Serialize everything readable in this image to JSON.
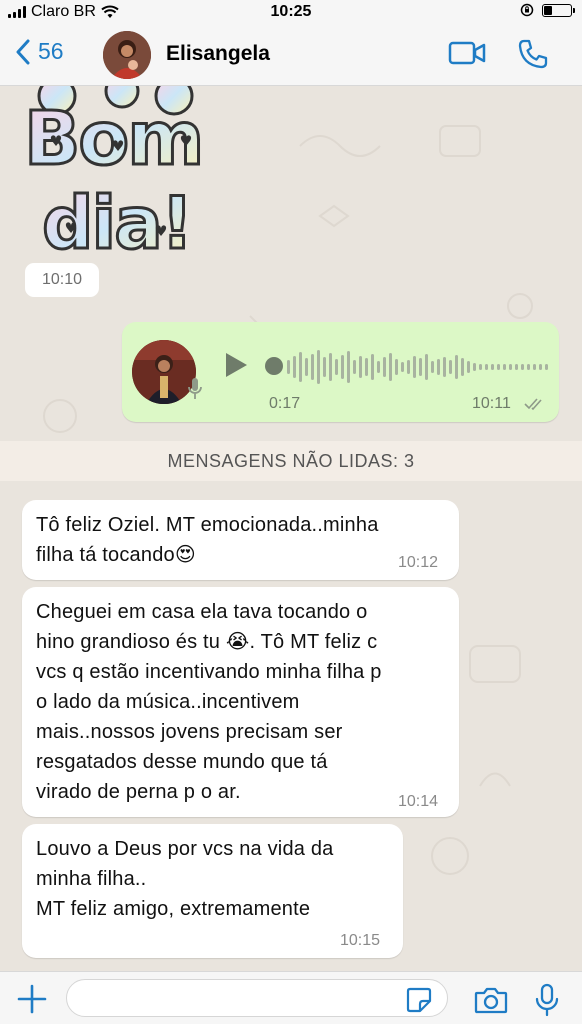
{
  "status_bar": {
    "carrier": "Claro BR",
    "time": "10:25"
  },
  "header": {
    "back_count": "56",
    "contact_name": "Elisangela"
  },
  "sticker": {
    "line1": "Bom",
    "line2": "dia!",
    "time": "10:10"
  },
  "voice_message": {
    "duration": "0:17",
    "time": "10:11",
    "status": "read"
  },
  "unread_banner": "MENSAGENS NÃO LIDAS: 3",
  "messages": [
    {
      "lines": [
        "Tô feliz Oziel. MT emocionada..minha",
        "filha tá tocando😍"
      ],
      "time": "10:12"
    },
    {
      "lines": [
        "Cheguei em casa ela tava tocando o",
        "hino grandioso és tu 😭. Tô MT feliz c",
        "vcs q estão incentivando minha filha p",
        "o lado da música..incentivem",
        "mais..nossos jovens precisam ser",
        "resgatados desse mundo que tá",
        "virado de perna p o ar."
      ],
      "time": "10:14"
    },
    {
      "lines": [
        "Louvo a Deus por vcs na vida da",
        "minha filha..",
        "MT feliz amigo, extremamente"
      ],
      "time": "10:15"
    }
  ],
  "input": {
    "value": ""
  },
  "colors": {
    "accent": "#1F7CC5",
    "outgoing_bubble": "#DCF8C6",
    "incoming_bubble": "#FFFFFF",
    "chat_background": "#E9E4DD"
  }
}
